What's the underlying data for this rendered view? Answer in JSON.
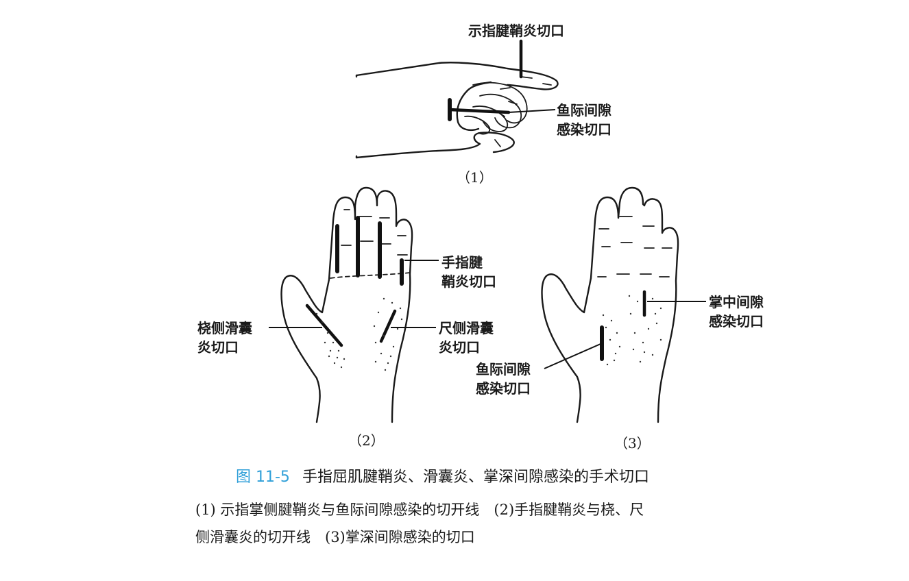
{
  "figure": {
    "panel1": {
      "label_top": "示指腱鞘炎切口",
      "label_thenar_1": "鱼际间隙",
      "label_thenar_2": "感染切口",
      "number": "（1）"
    },
    "panel2": {
      "label_finger_1": "手指腱",
      "label_finger_2": "鞘炎切口",
      "label_radial_1": "桡侧滑囊",
      "label_radial_2": "炎切口",
      "label_ulnar_1": "尺侧滑囊",
      "label_ulnar_2": "炎切口",
      "number": "（2）"
    },
    "panel3": {
      "label_mid_1": "掌中间隙",
      "label_mid_2": "感染切口",
      "label_thenar_1": "鱼际间隙",
      "label_thenar_2": "感染切口",
      "number": "（3）"
    }
  },
  "caption": {
    "fig_number": "图 11-5",
    "title": "手指屈肌腱鞘炎、滑囊炎、掌深间隙感染的手术切口",
    "line1": "(1) 示指掌侧腱鞘炎与鱼际间隙感染的切开线　(2)手指腱鞘炎与桡、尺",
    "line2": "侧滑囊炎的切开线　(3)掌深间隙感染的切口"
  }
}
